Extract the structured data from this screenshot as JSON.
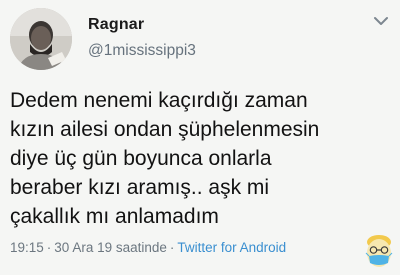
{
  "tweet": {
    "display_name": "Ragnar",
    "handle": "@1mississippi3",
    "text_lines": [
      "Dedem nenemi kaçırdığı zaman",
      "kızın ailesi ondan şüphelenmesin",
      "diye üç gün boyunca onlarla",
      "beraber kızı aramış.. aşk mi",
      "çakallık mı anlamadım"
    ],
    "time": "19:15",
    "date": "30 Ara 19 saatinde",
    "source": "Twitter for Android",
    "separator": "·"
  },
  "icons": {
    "avatar": "profile-photo",
    "menu": "chevron-down-icon",
    "sticker": "masked-face-sticker"
  },
  "colors": {
    "background": "#f5f6f4",
    "text": "#121212",
    "secondary": "#66727d",
    "link": "#3a8fd0"
  }
}
